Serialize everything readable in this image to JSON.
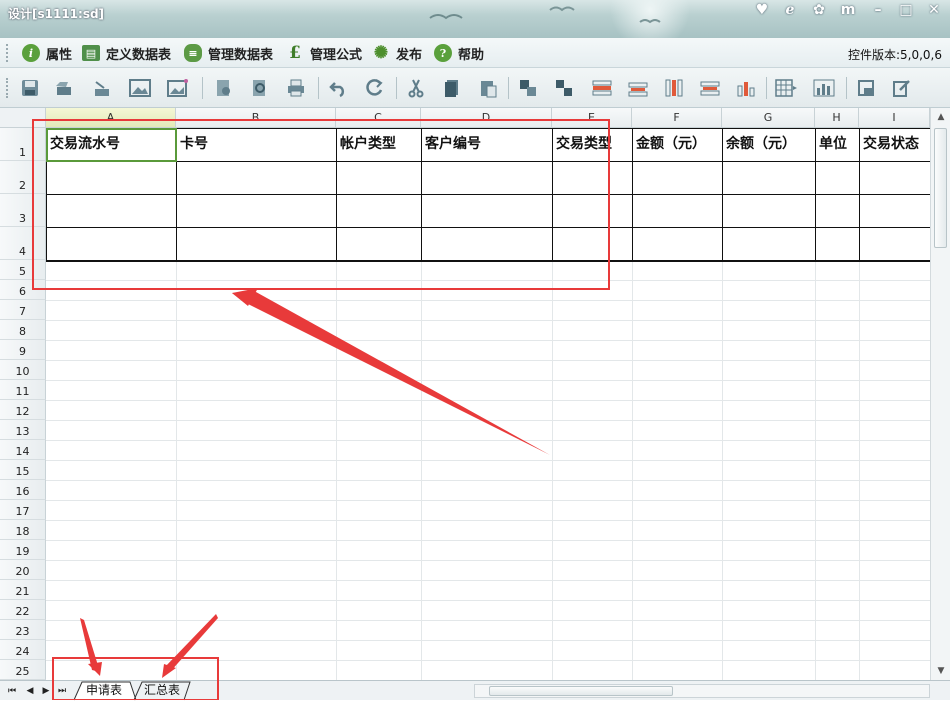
{
  "window": {
    "title": "设计[s1111:sd]"
  },
  "menu": [
    {
      "label": "属性",
      "icon": "info-icon"
    },
    {
      "label": "定义数据表",
      "icon": "define-table-icon"
    },
    {
      "label": "管理数据表",
      "icon": "database-icon"
    },
    {
      "label": "管理公式",
      "icon": "pound-formula-icon"
    },
    {
      "label": "发布",
      "icon": "gear-publish-icon"
    },
    {
      "label": "帮助",
      "icon": "help-icon"
    }
  ],
  "version_text": "控件版本:5,0,0,6",
  "toolbar_icons": [
    "save-icon",
    "open-icon",
    "import-icon",
    "insert-image-icon",
    "insert-picture-icon",
    "settings-doc-icon",
    "preview-icon",
    "print-icon",
    "undo-icon",
    "redo-icon",
    "cut-icon",
    "copy-icon",
    "paste-icon",
    "merge-cells-icon",
    "split-cells-icon",
    "insert-row-icon",
    "delete-row-icon",
    "insert-column-icon",
    "delete-column-icon",
    "column-chart-icon",
    "table-icon",
    "bar-chart-icon",
    "lock-icon",
    "edit-icon"
  ],
  "grid": {
    "columns": [
      "A",
      "B",
      "C",
      "D",
      "E",
      "F",
      "G",
      "H",
      "I"
    ],
    "rows": [
      "1",
      "2",
      "3",
      "4",
      "5",
      "6",
      "7",
      "8",
      "9",
      "10",
      "11",
      "12",
      "13",
      "14",
      "15",
      "16",
      "17",
      "18",
      "19",
      "20",
      "21",
      "22",
      "23",
      "24",
      "25"
    ],
    "header_cells": [
      "交易流水号",
      "卡号",
      "帐户类型",
      "客户编号",
      "交易类型",
      "金额（元）",
      "余额（元）",
      "单位",
      "交易状态"
    ]
  },
  "sheets": [
    {
      "label": "申请表",
      "active": true
    },
    {
      "label": "汇总表",
      "active": false
    }
  ],
  "annotation_color": "#e83a3a"
}
